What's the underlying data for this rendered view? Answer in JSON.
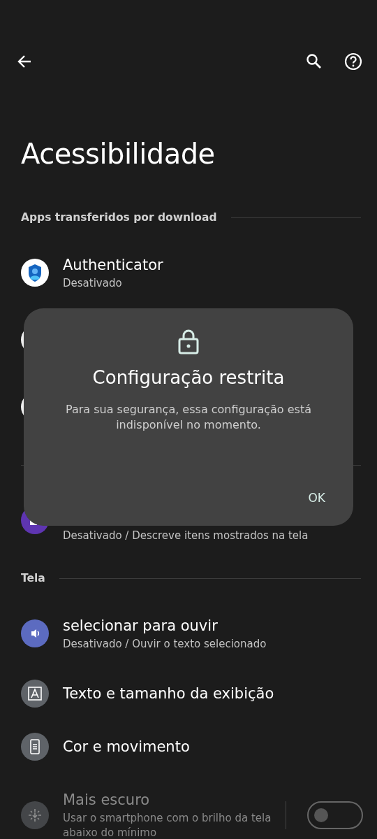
{
  "title": "Acessibilidade",
  "sections": [
    {
      "title": "Apps transferidos por download",
      "items": [
        {
          "kind": "authenticator",
          "title": "Authenticator",
          "subtitle": "Desativado"
        },
        {
          "kind": "covered"
        },
        {
          "kind": "covered"
        }
      ]
    },
    {
      "items": [
        {
          "kind": "reader",
          "subtitle": "Desativado / Descreve itens mostrados na tela"
        }
      ]
    },
    {
      "title": "Tela",
      "items": [
        {
          "kind": "speak",
          "title": "selecionar para ouvir",
          "subtitle": "Desativado / Ouvir o texto selecionado"
        },
        {
          "kind": "textsize",
          "title": "Texto e tamanho da exibição"
        },
        {
          "kind": "motion",
          "title": "Cor e movimento"
        },
        {
          "kind": "dim",
          "title": "Mais escuro",
          "subtitle": "Usar o smartphone com o brilho da tela abaixo do mínimo",
          "disabled": true,
          "on": false
        }
      ]
    }
  ],
  "dialog": {
    "title": "Configuração restrita",
    "message": "Para sua segurança, essa configuração está indisponível no momento.",
    "button": "OK"
  }
}
